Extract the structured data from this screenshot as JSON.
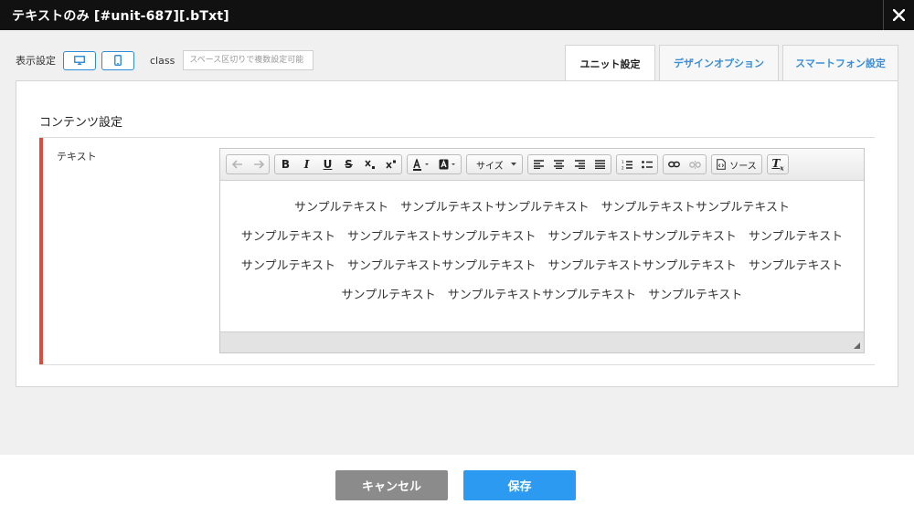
{
  "window": {
    "title": "テキストのみ [#unit-687][.bTxt]",
    "close_icon": "close-icon"
  },
  "display_settings": {
    "label": "表示設定",
    "devices": [
      {
        "icon": "desktop-icon"
      },
      {
        "icon": "mobile-icon"
      }
    ],
    "class_label": "class",
    "class_placeholder": "スペース区切りで複数設定可能"
  },
  "tabs": [
    {
      "label": "ユニット設定",
      "active": true
    },
    {
      "label": "デザインオプション",
      "active": false
    },
    {
      "label": "スマートフォン設定",
      "active": false
    }
  ],
  "content_settings": {
    "title": "コンテンツ設定"
  },
  "field": {
    "label": "テキスト"
  },
  "toolbar": {
    "size_label": "サイズ",
    "source_label": "ソース"
  },
  "editor": {
    "lines": [
      "サンプルテキスト　サンプルテキストサンプルテキスト　サンプルテキストサンプルテキスト",
      "サンプルテキスト　サンプルテキストサンプルテキスト　サンプルテキストサンプルテキスト　サンプルテキスト",
      "サンプルテキスト　サンプルテキストサンプルテキスト　サンプルテキストサンプルテキスト　サンプルテキスト",
      "サンプルテキスト　サンプルテキストサンプルテキスト　サンプルテキスト"
    ]
  },
  "footer": {
    "cancel_label": "キャンセル",
    "save_label": "保存"
  },
  "colors": {
    "accent": "#2b9af0",
    "field_marker": "#e04a3b",
    "cancel": "#8b8b8b",
    "titlebar": "#111111"
  }
}
